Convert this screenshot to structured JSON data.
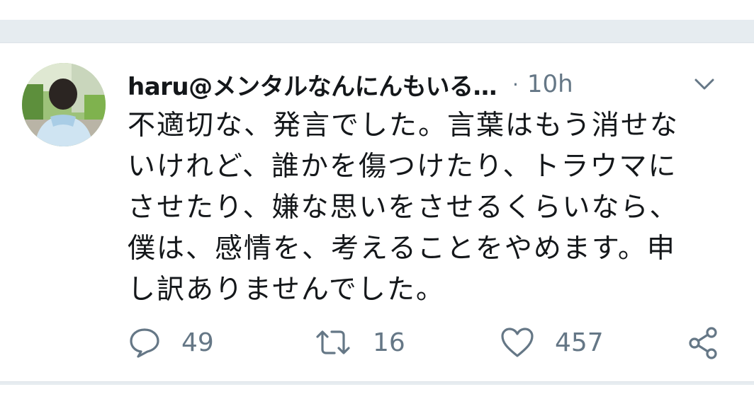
{
  "tweet": {
    "display_name": "haru@メンタルなんにんもいる…",
    "separator": "·",
    "timestamp": "10h",
    "text": "不適切な、発言でした。言葉はもう消せな\nいけれど、誰かを傷つけたり、トラウマに\nさせたり、嫌な思いをさせるくらいなら、\n僕は、感情を、考えることをやめます。申\nし訳ありませんでした。",
    "avatar_icon": "profile-photo",
    "menu_icon": "chevron-down-icon"
  },
  "actions": {
    "reply": {
      "icon": "reply-icon",
      "count": "49"
    },
    "retweet": {
      "icon": "retweet-icon",
      "count": "16"
    },
    "like": {
      "icon": "heart-icon",
      "count": "457"
    },
    "share": {
      "icon": "share-icon"
    }
  },
  "colors": {
    "background": "#e6ecf0",
    "card": "#ffffff",
    "primary_text": "#14171a",
    "secondary_text": "#657786"
  }
}
